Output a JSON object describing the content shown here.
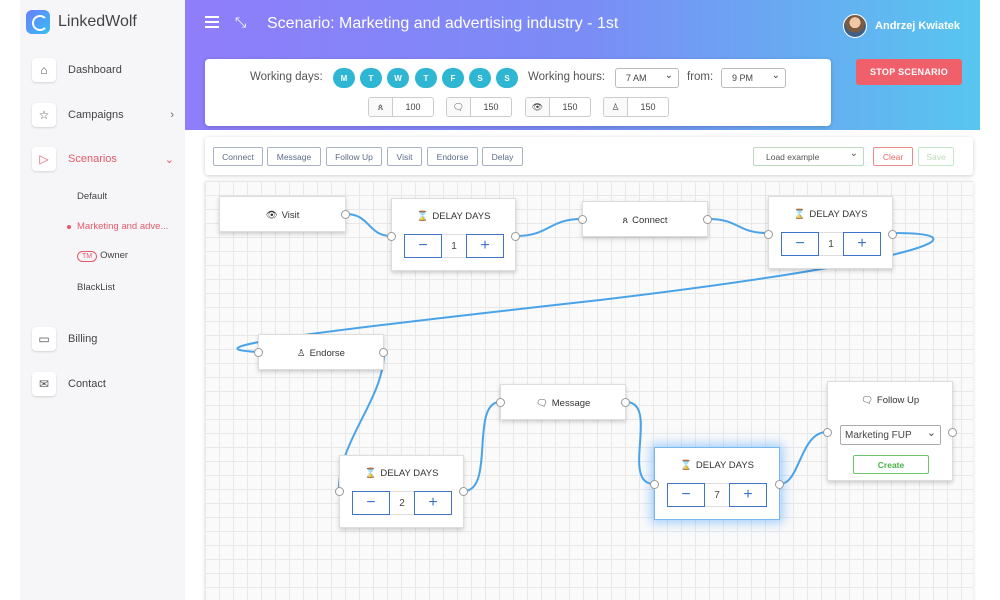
{
  "app": {
    "name": "LinkedWolf"
  },
  "sidebar": {
    "items": [
      {
        "label": "Dashboard",
        "icon": "home-icon"
      },
      {
        "label": "Campaigns",
        "icon": "star-icon"
      },
      {
        "label": "Scenarios",
        "icon": "play-icon"
      },
      {
        "label": "Billing",
        "icon": "card-icon"
      },
      {
        "label": "Contact",
        "icon": "mail-icon"
      }
    ],
    "sub_items": [
      "Default",
      "Marketing and adve...",
      "Owner",
      "BlackList"
    ],
    "owner_badge": "TM"
  },
  "header": {
    "title": "Scenario: Marketing and advertising industry - 1st",
    "user_name": "Andrzej Kwiatek",
    "stop_label": "STOP SCENARIO"
  },
  "config": {
    "working_days_label": "Working days:",
    "days": [
      "M",
      "T",
      "W",
      "T",
      "F",
      "S",
      "S"
    ],
    "working_hours_label": "Working hours:",
    "hours_start": "7 AM",
    "from_label": "from:",
    "hours_end": "9 PM",
    "limits": [
      {
        "icon": "users-icon",
        "value": "100"
      },
      {
        "icon": "message-icon",
        "value": "150"
      },
      {
        "icon": "eye-icon",
        "value": "150"
      },
      {
        "icon": "endorse-icon",
        "value": "150"
      }
    ]
  },
  "toolbar": {
    "buttons": [
      "Connect",
      "Message",
      "Follow Up",
      "Visit",
      "Endorse",
      "Delay"
    ],
    "load_example": "Load example",
    "clear": "Clear",
    "save": "Save"
  },
  "nodes": {
    "visit": "Visit",
    "delay_title": "DELAY DAYS",
    "delay1": "1",
    "connect": "Connect",
    "delay2": "1",
    "endorse": "Endorse",
    "delay3": "2",
    "message": "Message",
    "delay4": "7",
    "followup": "Follow Up",
    "followup_select": "Marketing FUP",
    "create": "Create",
    "minus": "−",
    "plus": "+"
  },
  "colors": {
    "accent": "#e5596b",
    "edge": "#4aa3e8",
    "day_pill": "#2eb6d3",
    "stop": "#f0606a"
  }
}
